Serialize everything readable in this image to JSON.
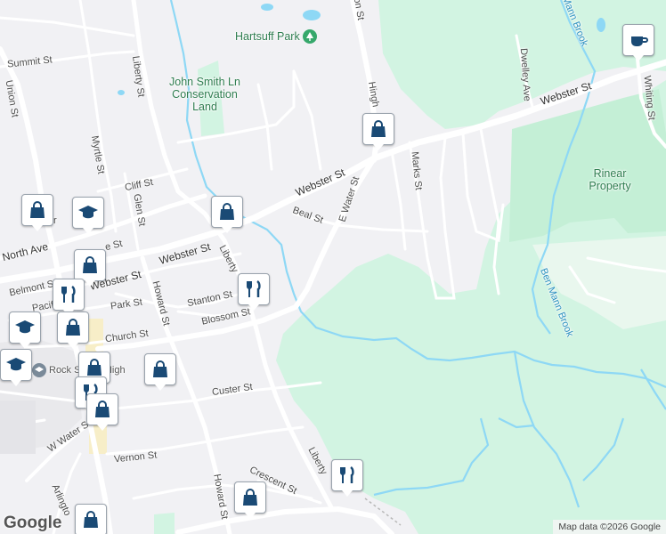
{
  "map": {
    "colors": {
      "land": "#f1f1f4",
      "park": "#d2f4e2",
      "water": "#8ed8f5",
      "road": "#ffffff",
      "marker": "#1a4a75"
    },
    "streets": {
      "summit": "Summit St",
      "union": "Union St",
      "liberty_n": "Liberty St",
      "myrtle": "Myrtle St",
      "cliff": "Cliff St",
      "glen": "Glen St",
      "north_ave": "North Ave",
      "webster_w": "Webster St",
      "webster_mid": "Webster St",
      "webster_e": "Webster St",
      "belmont": "Belmont St",
      "pacific": "Pacific",
      "park_st": "Park St",
      "howard_n": "Howard St",
      "stanton": "Stanton St",
      "blossom": "Blossom St",
      "church": "Church St",
      "liberty_mid": "Liberty",
      "beal": "Beal St",
      "e_water": "E Water St",
      "hingham": "Hingh",
      "union_top": "on St",
      "marks": "Marks St",
      "dwelley": "Dwelley Ave",
      "whiting": "Whiting St",
      "custer": "Custer St",
      "w_water": "W Water St",
      "vernon": "Vernon St",
      "arlington": "Arlingto",
      "crescent": "Crescent St",
      "howard_s": "Howard St",
      "liberty_s": "Liberty",
      "union_short": "Ur",
      "e_fragment": "e St"
    },
    "places": {
      "hartsuff_park": "Hartsuff Park",
      "john_smith": "John Smith Ln Conservation Land",
      "rinear": "Rinear Property",
      "rockland": "Rockland",
      "rockland_short": "Ro",
      "senior_high": "Rockland Senior High",
      "senior_high_short": "Rock  Senior High"
    },
    "water_labels": {
      "ben_mann_brook": "Ben Mann Brook",
      "mann_brook_top": "Mann Brook"
    },
    "markers": [
      {
        "id": "cafe",
        "icon": "cup-icon",
        "label": "cafe"
      },
      {
        "id": "shop-hingham",
        "icon": "bag-icon",
        "label": "shop"
      },
      {
        "id": "shop-beal",
        "icon": "bag-icon",
        "label": "shop"
      },
      {
        "id": "restaurant-blossom",
        "icon": "fork-knife-icon",
        "label": "restaurant"
      },
      {
        "id": "school-north",
        "icon": "graduation-cap-icon",
        "label": "school"
      },
      {
        "id": "shop-north",
        "icon": "bag-icon",
        "label": "shop"
      },
      {
        "id": "shop-liberty",
        "icon": "bag-icon",
        "label": "shop"
      },
      {
        "id": "shop-howard",
        "icon": "bag-icon",
        "label": "shop"
      },
      {
        "id": "restaurant-liberty-s",
        "icon": "fork-knife-icon",
        "label": "restaurant"
      },
      {
        "id": "shop-crescent",
        "icon": "bag-icon",
        "label": "shop"
      }
    ],
    "attribution": "Map data ©2026 Google",
    "logo": "Google"
  }
}
